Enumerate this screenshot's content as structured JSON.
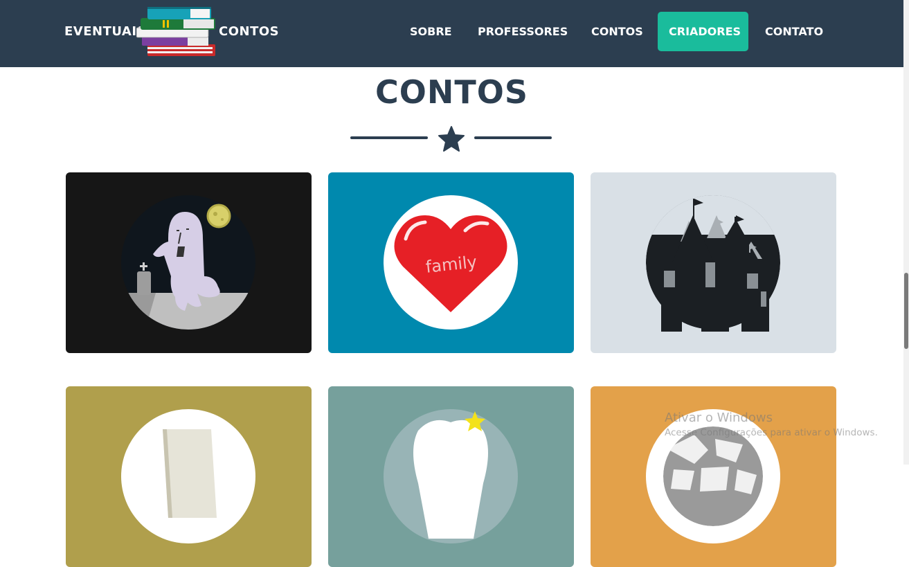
{
  "brand": {
    "left_text": "EVENTUAIS",
    "right_text": "CONTOS",
    "logo_icon": "books-stack-icon"
  },
  "nav": {
    "items": [
      {
        "label": "SOBRE",
        "active": false
      },
      {
        "label": "PROFESSORES",
        "active": false
      },
      {
        "label": "CONTOS",
        "active": false
      },
      {
        "label": "CRIADORES",
        "active": true
      },
      {
        "label": "CONTATO",
        "active": false
      }
    ]
  },
  "section": {
    "title": "CONTOS",
    "divider_icon": "star-icon"
  },
  "cards": [
    {
      "id": "ghost",
      "image_icon": "ghost-graveyard-icon",
      "background": "#161616"
    },
    {
      "id": "family",
      "image_icon": "family-heart-icon",
      "background": "#0089ae",
      "image_text": "family"
    },
    {
      "id": "castle",
      "image_icon": "castle-icon",
      "background": "#d9e0e6"
    },
    {
      "id": "paper",
      "image_icon": "paper-sheet-icon",
      "background": "#b09f4c"
    },
    {
      "id": "tooth",
      "image_icon": "tooth-star-icon",
      "background": "#76a09c"
    },
    {
      "id": "pattern",
      "image_icon": "stone-pattern-icon",
      "background": "#e3a14a"
    }
  ],
  "colors": {
    "navbar": "#2c3e50",
    "accent": "#1abc9c",
    "heading": "#2c3e50"
  },
  "watermark": {
    "title": "Ativar o Windows",
    "subtitle": "Acesse Configurações para ativar o Windows."
  }
}
